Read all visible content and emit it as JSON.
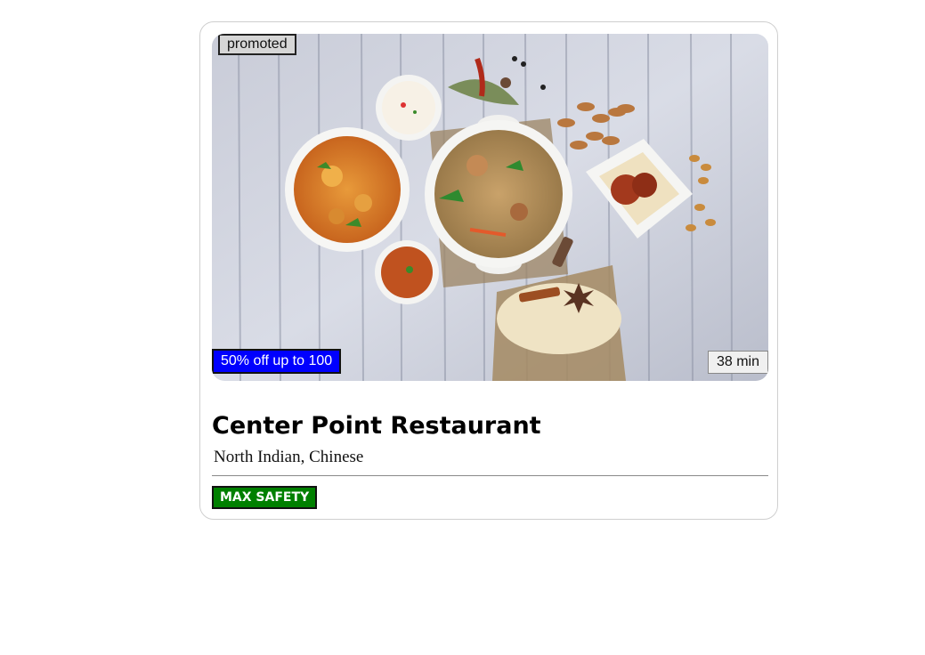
{
  "card": {
    "promoted_label": "promoted",
    "offer_label": "50% off up to 100",
    "delivery_time": "38 min",
    "restaurant_name": "Center Point Restaurant",
    "cuisines": "North Indian, Chinese",
    "safety_badge": "MAX SAFETY",
    "image_icon": "food-photo-icon"
  },
  "colors": {
    "offer_bg": "#0000ff",
    "safety_bg": "#008000",
    "promoted_bg": "#d6d6d6"
  }
}
